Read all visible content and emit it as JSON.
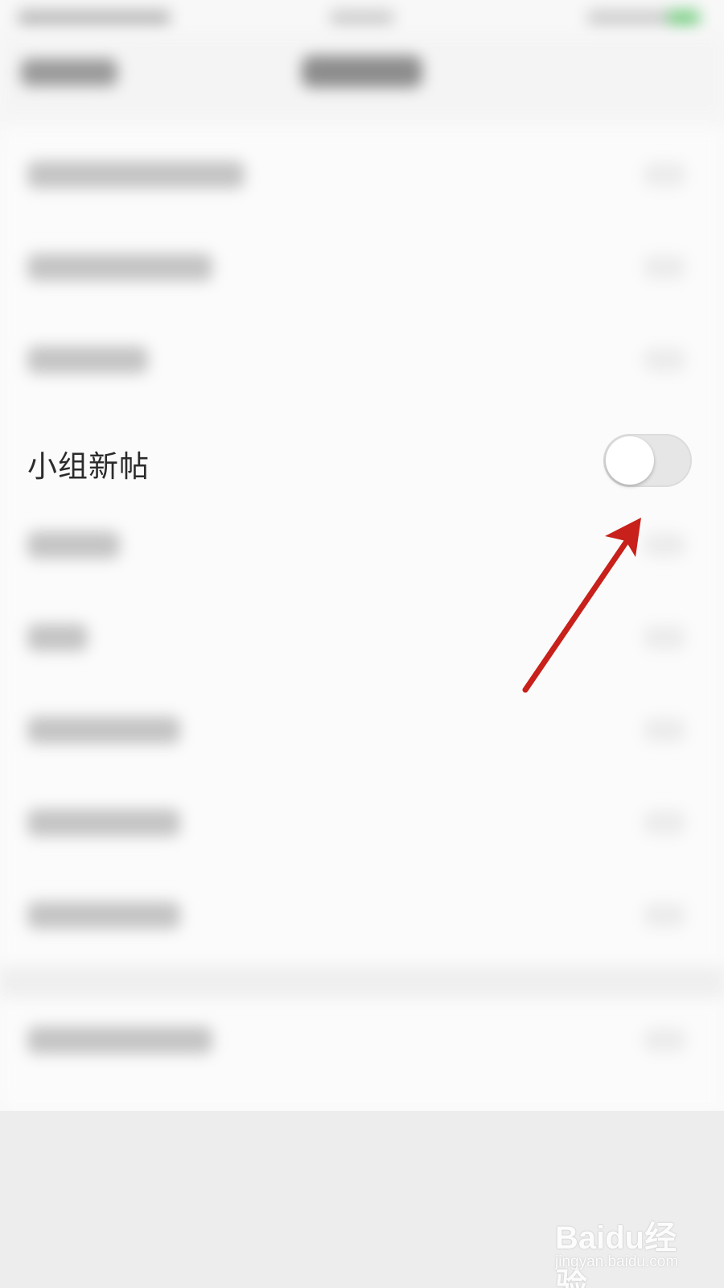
{
  "settings": {
    "focused_item": {
      "label": "小组新帖",
      "toggle_state": "off"
    }
  },
  "annotation": {
    "arrow_color": "#c8201a"
  },
  "watermark": {
    "brand": "Baidu经验",
    "url": "jingyan.baidu.com"
  }
}
